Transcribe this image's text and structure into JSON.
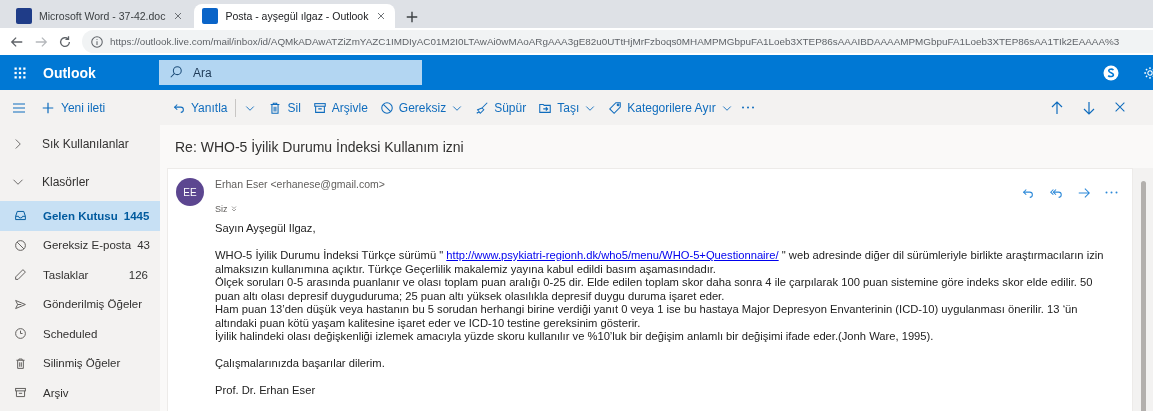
{
  "browser": {
    "tabs": [
      {
        "title": "Microsoft Word - 37-42.doc",
        "selected": false
      },
      {
        "title": "Posta - ayşegül ılgaz - Outlook",
        "selected": true
      }
    ],
    "url": "https://outlook.live.com/mail/inbox/id/AQMkADAwATZiZmYAZC1IMDIyAC01M2I0LTAwAi0wMAoARgAAA3gE82u0UTtHjMrFzboqs0MHAMPMGbpuFA1Loeb3XTEP86sAAAIBDAAAAMPMGbpuFA1Loeb3XTEP86sAA1TIk2EAAAA%3"
  },
  "app": {
    "name": "Outlook",
    "search": {
      "placeholder": "Ara"
    }
  },
  "new_message": "Yeni ileti",
  "commands": [
    {
      "label": "Yanıtla",
      "kind": "split"
    },
    {
      "label": "Sil",
      "kind": "plain"
    },
    {
      "label": "Arşivle",
      "kind": "plain"
    },
    {
      "label": "Gereksiz",
      "kind": "dropdown"
    },
    {
      "label": "Süpür",
      "kind": "plain"
    },
    {
      "label": "Taşı",
      "kind": "dropdown"
    },
    {
      "label": "Kategorilere Ayır",
      "kind": "dropdown"
    }
  ],
  "sidebar": {
    "sections": [
      {
        "label": "Sık Kullanılanlar",
        "expanded": false
      },
      {
        "label": "Klasörler",
        "expanded": true,
        "children": [
          {
            "label": "Gelen Kutusu",
            "count": "1445",
            "selected": true
          },
          {
            "label": "Gereksiz E-posta",
            "count": "43",
            "selected": false
          },
          {
            "label": "Taslaklar",
            "count": "126",
            "selected": false
          },
          {
            "label": "Gönderilmiş Öğeler",
            "selected": false
          },
          {
            "label": "Scheduled",
            "selected": false
          },
          {
            "label": "Silinmiş Öğeler",
            "selected": false
          },
          {
            "label": "Arşiv",
            "selected": false
          }
        ]
      }
    ]
  },
  "message": {
    "subject": "Re: WHO-5 İyilik Durumu İndeksi Kullanım izni",
    "avatar": "EE",
    "sender": "Erhan Eser <erhanese@gmail.com>",
    "recipient": "Siz",
    "body": [
      [
        {
          "kind": "text",
          "text": "Sayın Ayşegül Ilgaz,"
        }
      ],
      [
        {
          "kind": "link_line",
          "text": "WHO-5 İyilik Durumu İndeksi Türkçe sürümü \" ",
          "link": "http://www.psykiatri-regionh.dk/who5/menu/WHO-5+Questionnaire/",
          "after": "  \" web adresinde diğer dil sürümleriyle birlikte araştırmacıların izin almaksızın kullanımına açıktır. Türkçe Geçerlilik makalemiz yayına kabul edildi basım aşamasındadır."
        },
        {
          "kind": "text",
          "text": "Ölçek soruları 0-5 arasında puanlanır ve olası toplam puan aralığı 0-25 dir. Elde edilen toplam skor daha sonra 4 ile çarpılarak 100 puan sistemine göre indeks skor elde edilir. 50 puan altı olası depresif duyguduruma; 25 puan altı yüksek olasılıkla depresif duygu duruma işaret eder."
        },
        {
          "kind": "text",
          "text": "Ham puan 13’den düşük veya hastanın bu 5 sorudan herhangi birine verdiği yanıt 0 veya 1 ise bu hastaya Major Depresyon Envanterinin (ICD-10) uygulanması önerilir. 13 ‘ün altındaki puan kötü yaşam kalitesine işaret eder ve ICD-10 testine gereksinim gösterir."
        },
        {
          "kind": "text",
          "text": "İyilik halindeki olası değişkenliği izlemek amacıyla yüzde skoru kullanılır ve %10’luk bir değişim anlamlı bir değişimi ifade eder.(Jonh Ware, 1995)."
        }
      ],
      [
        {
          "kind": "text",
          "text": "Çalışmalarınızda başarılar dilerim."
        }
      ],
      [
        {
          "kind": "text",
          "text": "Prof. Dr. Erhan Eser"
        }
      ]
    ]
  }
}
